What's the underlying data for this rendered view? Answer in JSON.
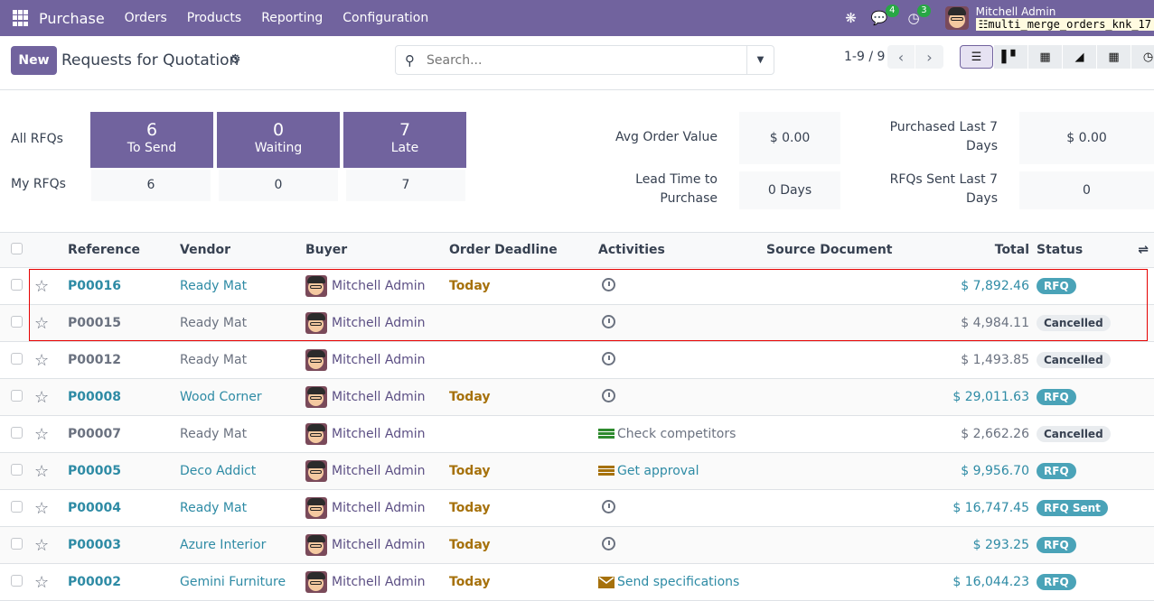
{
  "navbar": {
    "app_name": "Purchase",
    "menu": [
      "Orders",
      "Products",
      "Reporting",
      "Configuration"
    ],
    "messages_count": "4",
    "activities_count": "3",
    "user_name": "Mitchell Admin",
    "database": "multi_merge_orders_knk_17"
  },
  "control_panel": {
    "new_label": "New",
    "title": "Requests for Quotation",
    "search_placeholder": "Search...",
    "pager": "1-9 / 9",
    "views": [
      "list",
      "kanban",
      "pivot",
      "graph",
      "calendar",
      "activity"
    ]
  },
  "dashboard": {
    "all_rfqs_label": "All RFQs",
    "my_rfqs_label": "My RFQs",
    "tiles": [
      {
        "count": "6",
        "label": "To Send",
        "my": "6"
      },
      {
        "count": "0",
        "label": "Waiting",
        "my": "0"
      },
      {
        "count": "7",
        "label": "Late",
        "my": "7"
      }
    ],
    "kpis": {
      "avg_order_value_label": "Avg Order Value",
      "avg_order_value": "$ 0.00",
      "purchased_label_1": "Purchased Last 7",
      "purchased_label_2": "Days",
      "purchased": "$ 0.00",
      "lead_time_label_1": "Lead Time to",
      "lead_time_label_2": "Purchase",
      "lead_time": "0 Days",
      "rfqs_sent_label_1": "RFQs Sent Last 7",
      "rfqs_sent_label_2": "Days",
      "rfqs_sent": "0"
    }
  },
  "table": {
    "headers": {
      "reference": "Reference",
      "vendor": "Vendor",
      "buyer": "Buyer",
      "deadline": "Order Deadline",
      "activities": "Activities",
      "source": "Source Document",
      "total": "Total",
      "status": "Status"
    },
    "rows": [
      {
        "ref": "P00016",
        "vendor": "Ready Mat",
        "buyer": "Mitchell Admin",
        "deadline": "Today",
        "activity": "",
        "total": "$ 7,892.46",
        "status": "RFQ"
      },
      {
        "ref": "P00015",
        "vendor": "Ready Mat",
        "buyer": "Mitchell Admin",
        "deadline": "",
        "activity": "",
        "total": "$ 4,984.11",
        "status": "Cancelled"
      },
      {
        "ref": "P00012",
        "vendor": "Ready Mat",
        "buyer": "Mitchell Admin",
        "deadline": "",
        "activity": "",
        "total": "$ 1,493.85",
        "status": "Cancelled"
      },
      {
        "ref": "P00008",
        "vendor": "Wood Corner",
        "buyer": "Mitchell Admin",
        "deadline": "Today",
        "activity": "",
        "total": "$ 29,011.63",
        "status": "RFQ"
      },
      {
        "ref": "P00007",
        "vendor": "Ready Mat",
        "buyer": "Mitchell Admin",
        "deadline": "",
        "activity": "Check competitors",
        "total": "$ 2,662.26",
        "status": "Cancelled"
      },
      {
        "ref": "P00005",
        "vendor": "Deco Addict",
        "buyer": "Mitchell Admin",
        "deadline": "Today",
        "activity": "Get approval",
        "total": "$ 9,956.70",
        "status": "RFQ"
      },
      {
        "ref": "P00004",
        "vendor": "Ready Mat",
        "buyer": "Mitchell Admin",
        "deadline": "Today",
        "activity": "",
        "total": "$ 16,747.45",
        "status": "RFQ Sent"
      },
      {
        "ref": "P00003",
        "vendor": "Azure Interior",
        "buyer": "Mitchell Admin",
        "deadline": "Today",
        "activity": "",
        "total": "$ 293.25",
        "status": "RFQ"
      },
      {
        "ref": "P00002",
        "vendor": "Gemini Furniture",
        "buyer": "Mitchell Admin",
        "deadline": "Today",
        "activity": "Send specifications",
        "total": "$ 16,044.23",
        "status": "RFQ"
      }
    ]
  },
  "colors": {
    "brand": "#71639e",
    "link": "#2e8ba5",
    "today": "#a6710b",
    "status_rfq": "#4aa3b8",
    "highlight": "#e60000"
  }
}
